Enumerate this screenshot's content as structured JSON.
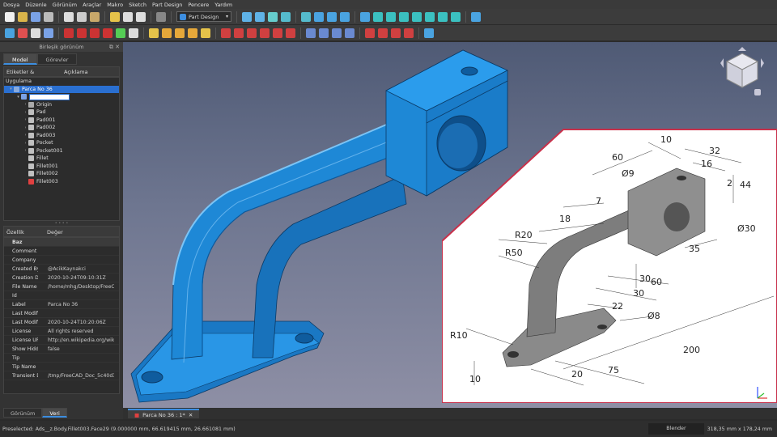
{
  "menu": [
    "Dosya",
    "Düzenle",
    "Görünüm",
    "Araçlar",
    "Makro",
    "Sketch",
    "Part Design",
    "Pencere",
    "Yardım"
  ],
  "workbench": {
    "label": "Part Design"
  },
  "combo": {
    "title": "Birleşik görünüm",
    "tab_model": "Model",
    "tab_tasks": "Görevler"
  },
  "tree": {
    "col_labels": "Etiketler & öznitelikleri",
    "col_desc": "Açıklama",
    "root": "Uygulama",
    "items": [
      {
        "label": "Parca No 36",
        "indent": 1,
        "arrow": "▾",
        "selected": true,
        "color": "#88aadd"
      },
      {
        "label": "",
        "indent": 2,
        "arrow": "▾",
        "selected": false,
        "color": "#7aa2e6",
        "edit": true
      },
      {
        "label": "Origin",
        "indent": 3,
        "arrow": "›",
        "selected": false,
        "color": "#aaaaaa"
      },
      {
        "label": "Pad",
        "indent": 3,
        "arrow": "›",
        "selected": false,
        "color": "#c0c0c0"
      },
      {
        "label": "Pad001",
        "indent": 3,
        "arrow": "›",
        "selected": false,
        "color": "#c0c0c0"
      },
      {
        "label": "Pad002",
        "indent": 3,
        "arrow": "›",
        "selected": false,
        "color": "#c0c0c0"
      },
      {
        "label": "Pad003",
        "indent": 3,
        "arrow": "›",
        "selected": false,
        "color": "#c0c0c0"
      },
      {
        "label": "Pocket",
        "indent": 3,
        "arrow": "›",
        "selected": false,
        "color": "#c0c0c0"
      },
      {
        "label": "Pocket001",
        "indent": 3,
        "arrow": "›",
        "selected": false,
        "color": "#c0c0c0"
      },
      {
        "label": "Fillet",
        "indent": 3,
        "arrow": "",
        "selected": false,
        "color": "#c0c0c0"
      },
      {
        "label": "Fillet001",
        "indent": 3,
        "arrow": "",
        "selected": false,
        "color": "#c0c0c0"
      },
      {
        "label": "Fillet002",
        "indent": 3,
        "arrow": "",
        "selected": false,
        "color": "#c0c0c0"
      },
      {
        "label": "Fillet003",
        "indent": 3,
        "arrow": "",
        "selected": false,
        "color": "#e04040"
      }
    ]
  },
  "props": {
    "col_prop": "Özellik",
    "col_val": "Değer",
    "rows": [
      {
        "k": "Baz",
        "v": "",
        "grp": true
      },
      {
        "k": "Comment",
        "v": ""
      },
      {
        "k": "Company",
        "v": ""
      },
      {
        "k": "Created By",
        "v": "@AcikKaynakci"
      },
      {
        "k": "Creation D...",
        "v": "2020-10-24T09:10:31Z"
      },
      {
        "k": "File Name",
        "v": "/home/mhg/Desktop/FreeCA..."
      },
      {
        "k": "Id",
        "v": ""
      },
      {
        "k": "Label",
        "v": "Parca No 36"
      },
      {
        "k": "Last Modifi...",
        "v": ""
      },
      {
        "k": "Last Modifi...",
        "v": "2020-10-24T10:20:06Z"
      },
      {
        "k": "License",
        "v": "All rights reserved"
      },
      {
        "k": "License URL",
        "v": "http://en.wikipedia.org/wiki/A..."
      },
      {
        "k": "Show Hidd...",
        "v": "false"
      },
      {
        "k": "Tip",
        "v": ""
      },
      {
        "k": "Tip Name",
        "v": ""
      },
      {
        "k": "Transient Dir",
        "v": "/tmp/FreeCAD_Doc_5c40d3a9..."
      }
    ]
  },
  "bottom_tabs": {
    "view": "Görünüm",
    "data": "Veri"
  },
  "doc_tab": {
    "label": "Parca No 36 : 1*"
  },
  "status": {
    "message": "Preselected: Ads__z.Body.Fillet003.Face29 (9.000000 mm, 66.619415 mm, 26.661081 mm)",
    "nav": "Blender",
    "dims": "318,35 mm x 178,24 mm"
  },
  "drawing": {
    "dims": [
      "60",
      "10",
      "32",
      "16",
      "Ø9",
      "2",
      "44",
      "7",
      "18",
      "R20",
      "R50",
      "Ø30",
      "35",
      "30",
      "60",
      "30",
      "22",
      "Ø8",
      "R10",
      "200",
      "75",
      "20",
      "10"
    ]
  },
  "axes": {
    "x": "x",
    "y": "y",
    "z": "z"
  },
  "colors": {
    "part_blue": "#1e88d6",
    "selection": "#2a6fd0",
    "inset_border": "#c8304a"
  }
}
